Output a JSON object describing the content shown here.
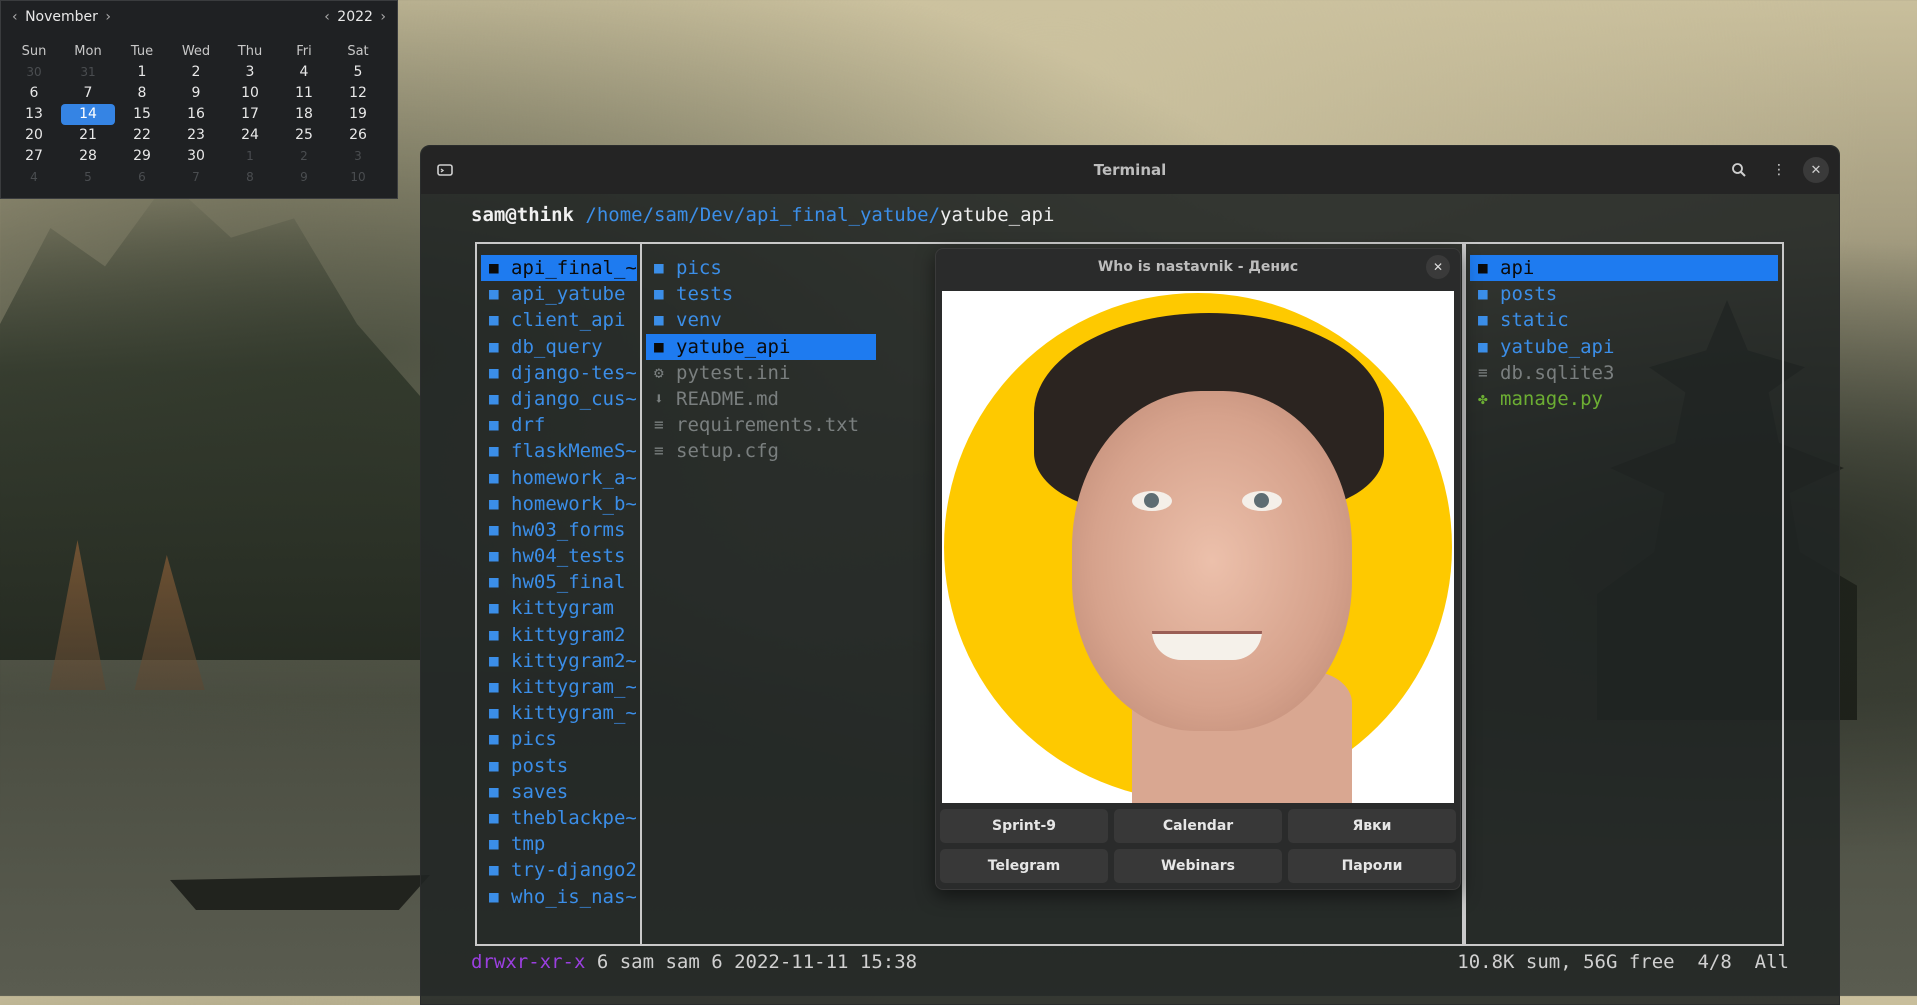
{
  "calendar": {
    "month": "November",
    "year": "2022",
    "weekdays": [
      "Sun",
      "Mon",
      "Tue",
      "Wed",
      "Thu",
      "Fri",
      "Sat"
    ],
    "weeks": [
      [
        "30",
        "31",
        "1",
        "2",
        "3",
        "4",
        "5"
      ],
      [
        "6",
        "7",
        "8",
        "9",
        "10",
        "11",
        "12"
      ],
      [
        "13",
        "14",
        "15",
        "16",
        "17",
        "18",
        "19"
      ],
      [
        "20",
        "21",
        "22",
        "23",
        "24",
        "25",
        "26"
      ],
      [
        "27",
        "28",
        "29",
        "30",
        "1",
        "2",
        "3"
      ],
      [
        "4",
        "5",
        "6",
        "7",
        "8",
        "9",
        "10"
      ]
    ],
    "selected_day": "14"
  },
  "terminal": {
    "title": "Terminal",
    "prompt_user": "sam@think",
    "prompt_path": "/home/sam/Dev/api_final_yatube/",
    "prompt_current": "yatube_api",
    "left_pane": [
      {
        "name": "api_final_~",
        "type": "dir",
        "selected": true
      },
      {
        "name": "api_yatube",
        "type": "dir"
      },
      {
        "name": "client_api",
        "type": "dir"
      },
      {
        "name": "db_query",
        "type": "dir"
      },
      {
        "name": "django-tes~",
        "type": "dir"
      },
      {
        "name": "django_cus~",
        "type": "dir"
      },
      {
        "name": "drf",
        "type": "dir"
      },
      {
        "name": "flaskMemeS~",
        "type": "dir"
      },
      {
        "name": "homework_a~",
        "type": "dir"
      },
      {
        "name": "homework_b~",
        "type": "dir"
      },
      {
        "name": "hw03_forms",
        "type": "dir"
      },
      {
        "name": "hw04_tests",
        "type": "dir"
      },
      {
        "name": "hw05_final",
        "type": "dir"
      },
      {
        "name": "kittygram",
        "type": "dir"
      },
      {
        "name": "kittygram2",
        "type": "dir"
      },
      {
        "name": "kittygram2~",
        "type": "dir"
      },
      {
        "name": "kittygram_~",
        "type": "dir"
      },
      {
        "name": "kittygram_~",
        "type": "dir"
      },
      {
        "name": "pics",
        "type": "dir"
      },
      {
        "name": "posts",
        "type": "dir"
      },
      {
        "name": "saves",
        "type": "dir"
      },
      {
        "name": "theblackpe~",
        "type": "dir"
      },
      {
        "name": "tmp",
        "type": "dir"
      },
      {
        "name": "try-django2",
        "type": "dir"
      },
      {
        "name": "who_is_nas~",
        "type": "dir"
      }
    ],
    "middle_pane": [
      {
        "name": "pics",
        "type": "dir"
      },
      {
        "name": "tests",
        "type": "dir"
      },
      {
        "name": "venv",
        "type": "dir"
      },
      {
        "name": "yatube_api",
        "type": "dir",
        "selected": true
      },
      {
        "name": "pytest.ini",
        "type": "config"
      },
      {
        "name": "README.md",
        "type": "download"
      },
      {
        "name": "requirements.txt",
        "type": "file"
      },
      {
        "name": "setup.cfg",
        "type": "file"
      }
    ],
    "right_pane": [
      {
        "name": "api",
        "type": "dir",
        "selected": true
      },
      {
        "name": "posts",
        "type": "dir"
      },
      {
        "name": "static",
        "type": "dir"
      },
      {
        "name": "yatube_api",
        "type": "dir"
      },
      {
        "name": "db.sqlite3",
        "type": "file"
      },
      {
        "name": "manage.py",
        "type": "exec"
      }
    ],
    "status_perm": "drwxr-xr-x",
    "status_info": " 6 sam sam 6 2022-11-11 15:38",
    "status_right": "10.8K sum, 56G free  4/8  All"
  },
  "popup": {
    "title": "Who is nastavnik - Денис",
    "buttons": [
      "Sprint-9",
      "Calendar",
      "Явки",
      "Telegram",
      "Webinars",
      "Пароли"
    ]
  },
  "icons": {
    "folder": "folder-icon",
    "gear": "gear-icon",
    "download": "download-icon",
    "file": "file-icon",
    "puzzle": "puzzle-icon"
  }
}
